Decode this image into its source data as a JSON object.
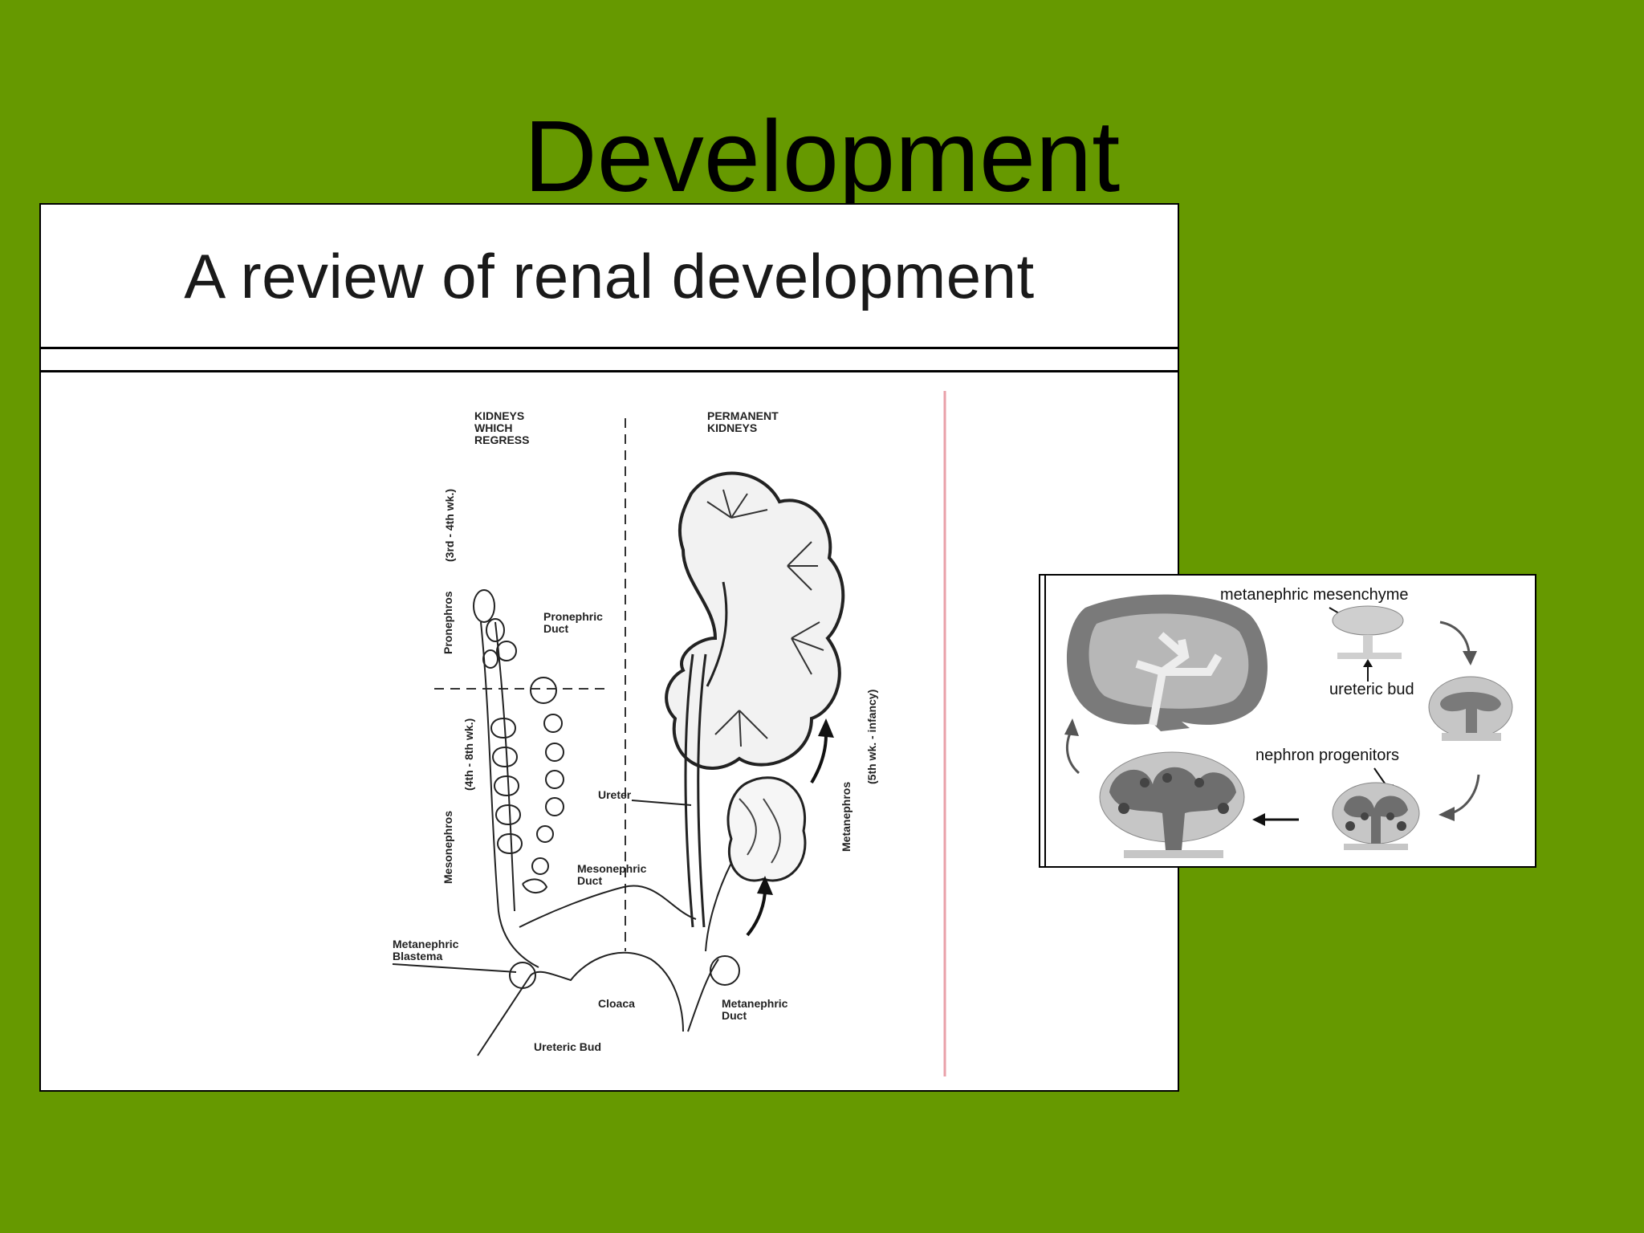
{
  "slide": {
    "title": "Development",
    "background_color": "#669900"
  },
  "left_figure": {
    "heading": "A review of renal development",
    "labels": {
      "kidneys_regress": [
        "KIDNEYS",
        "WHICH",
        "REGRESS"
      ],
      "permanent": [
        "PERMANENT",
        "KIDNEYS"
      ],
      "pronephros": "Pronephros",
      "pronephros_time": "(3rd - 4th wk.)",
      "pronephric_duct": [
        "Pronephric",
        "Duct"
      ],
      "mesonephros": "Mesonephros",
      "mesonephros_time": "(4th - 8th wk.)",
      "ureter": "Ureter",
      "mesonephric_duct": [
        "Mesonephric",
        "Duct"
      ],
      "metanephric_blastema": [
        "Metanephric",
        "Blastema"
      ],
      "cloaca": "Cloaca",
      "metanephric_duct": [
        "Metanephric",
        "Duct"
      ],
      "ureteric_bud": "Ureteric Bud",
      "metanephros": "Metanephros",
      "metanephros_time": "(5th wk. - infancy)"
    }
  },
  "inset_figure": {
    "labels": {
      "metanephric_mesenchyme": "metanephric mesenchyme",
      "ureteric_bud": "ureteric bud",
      "nephron_progenitors": "nephron progenitors"
    }
  }
}
